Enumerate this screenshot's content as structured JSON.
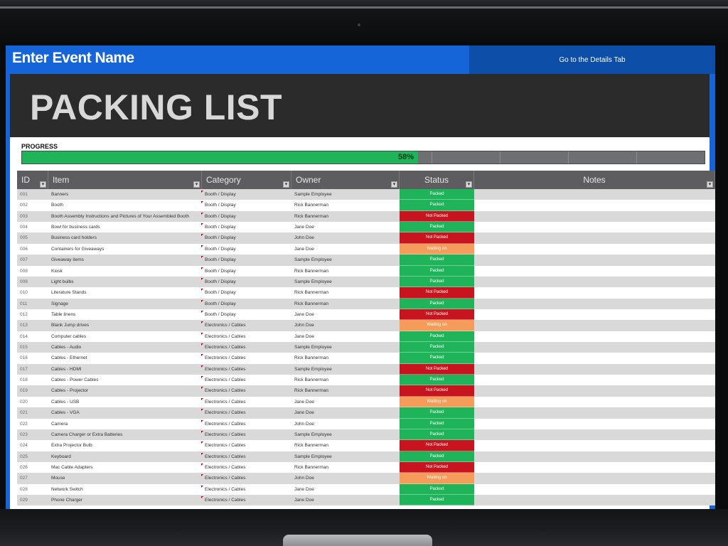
{
  "header": {
    "event_name": "Enter Event Name",
    "details_link": "Go to the Details Tab"
  },
  "title": "PACKING LIST",
  "progress": {
    "label": "PROGRESS",
    "value_percent": 58,
    "display": "58%"
  },
  "columns": [
    {
      "key": "id",
      "label": "ID"
    },
    {
      "key": "item",
      "label": "Item"
    },
    {
      "key": "category",
      "label": "Category"
    },
    {
      "key": "owner",
      "label": "Owner"
    },
    {
      "key": "status",
      "label": "Status"
    },
    {
      "key": "notes",
      "label": "Notes"
    }
  ],
  "status_colors": {
    "Packed": "#1fb35a",
    "Not Packed": "#c8141e",
    "Waiting on": "#f59c5a"
  },
  "rows": [
    {
      "id": "001",
      "item": "Banners",
      "category": "Booth / Display",
      "owner": "Sample Employee",
      "status": "Packed"
    },
    {
      "id": "002",
      "item": "Booth",
      "category": "Booth / Display",
      "owner": "Rick Bannerman",
      "status": "Packed"
    },
    {
      "id": "003",
      "item": "Booth Assembly Instructions and Pictures of Your Assembled Booth",
      "category": "Booth / Display",
      "owner": "Rick Bannerman",
      "status": "Not Packed"
    },
    {
      "id": "004",
      "item": "Bowl for business cards",
      "category": "Booth / Display",
      "owner": "Jane Doe",
      "status": "Packed"
    },
    {
      "id": "005",
      "item": "Business card holders",
      "category": "Booth / Display",
      "owner": "John Doe",
      "status": "Not Packed"
    },
    {
      "id": "006",
      "item": "Containers for Giveaways",
      "category": "Booth / Display",
      "owner": "Jane Doe",
      "status": "Waiting on"
    },
    {
      "id": "007",
      "item": "Giveaway items",
      "category": "Booth / Display",
      "owner": "Sample Employee",
      "status": "Packed"
    },
    {
      "id": "008",
      "item": "Kiosk",
      "category": "Booth / Display",
      "owner": "Rick Bannerman",
      "status": "Packed"
    },
    {
      "id": "009",
      "item": "Light bulbs",
      "category": "Booth / Display",
      "owner": "Sample Employee",
      "status": "Packed"
    },
    {
      "id": "010",
      "item": "Literature Stands",
      "category": "Booth / Display",
      "owner": "Rick Bannerman",
      "status": "Not Packed"
    },
    {
      "id": "011",
      "item": "Signage",
      "category": "Booth / Display",
      "owner": "Rick Bannerman",
      "status": "Packed"
    },
    {
      "id": "012",
      "item": "Table linens",
      "category": "Booth / Display",
      "owner": "Jane Doe",
      "status": "Not Packed"
    },
    {
      "id": "013",
      "item": "Blank Jump drives",
      "category": "Electronics / Cables",
      "owner": "John Doe",
      "status": "Waiting on"
    },
    {
      "id": "014",
      "item": "Computer cables",
      "category": "Electronics / Cables",
      "owner": "Jane Doe",
      "status": "Packed"
    },
    {
      "id": "015",
      "item": "Cables - Audio",
      "category": "Electronics / Cables",
      "owner": "Sample Employee",
      "status": "Packed"
    },
    {
      "id": "016",
      "item": "Cables - Ethernet",
      "category": "Electronics / Cables",
      "owner": "Rick Bannerman",
      "status": "Packed"
    },
    {
      "id": "017",
      "item": "Cables - HDMI",
      "category": "Electronics / Cables",
      "owner": "Sample Employee",
      "status": "Not Packed"
    },
    {
      "id": "018",
      "item": "Cables - Power Cables",
      "category": "Electronics / Cables",
      "owner": "Rick Bannerman",
      "status": "Packed"
    },
    {
      "id": "019",
      "item": "Cables - Projector",
      "category": "Electronics / Cables",
      "owner": "Rick Bannerman",
      "status": "Not Packed"
    },
    {
      "id": "020",
      "item": "Cables - USB",
      "category": "Electronics / Cables",
      "owner": "Jane Doe",
      "status": "Waiting on"
    },
    {
      "id": "021",
      "item": "Cables - VGA",
      "category": "Electronics / Cables",
      "owner": "Jane Doe",
      "status": "Packed"
    },
    {
      "id": "022",
      "item": "Camera",
      "category": "Electronics / Cables",
      "owner": "John Doe",
      "status": "Packed"
    },
    {
      "id": "023",
      "item": "Camera Charger or Extra Batteries",
      "category": "Electronics / Cables",
      "owner": "Sample Employee",
      "status": "Packed"
    },
    {
      "id": "024",
      "item": "Extra Projector Bulb",
      "category": "Electronics / Cables",
      "owner": "Rick Bannerman",
      "status": "Not Packed"
    },
    {
      "id": "025",
      "item": "Keyboard",
      "category": "Electronics / Cables",
      "owner": "Sample Employee",
      "status": "Packed"
    },
    {
      "id": "026",
      "item": "Mac Cable Adapters",
      "category": "Electronics / Cables",
      "owner": "Rick Bannerman",
      "status": "Not Packed"
    },
    {
      "id": "027",
      "item": "Mouse",
      "category": "Electronics / Cables",
      "owner": "John Doe",
      "status": "Waiting on"
    },
    {
      "id": "028",
      "item": "Network Switch",
      "category": "Electronics / Cables",
      "owner": "Jane Doe",
      "status": "Packed"
    },
    {
      "id": "029",
      "item": "Phone Charger",
      "category": "Electronics / Cables",
      "owner": "Jane Doe",
      "status": "Packed"
    }
  ]
}
